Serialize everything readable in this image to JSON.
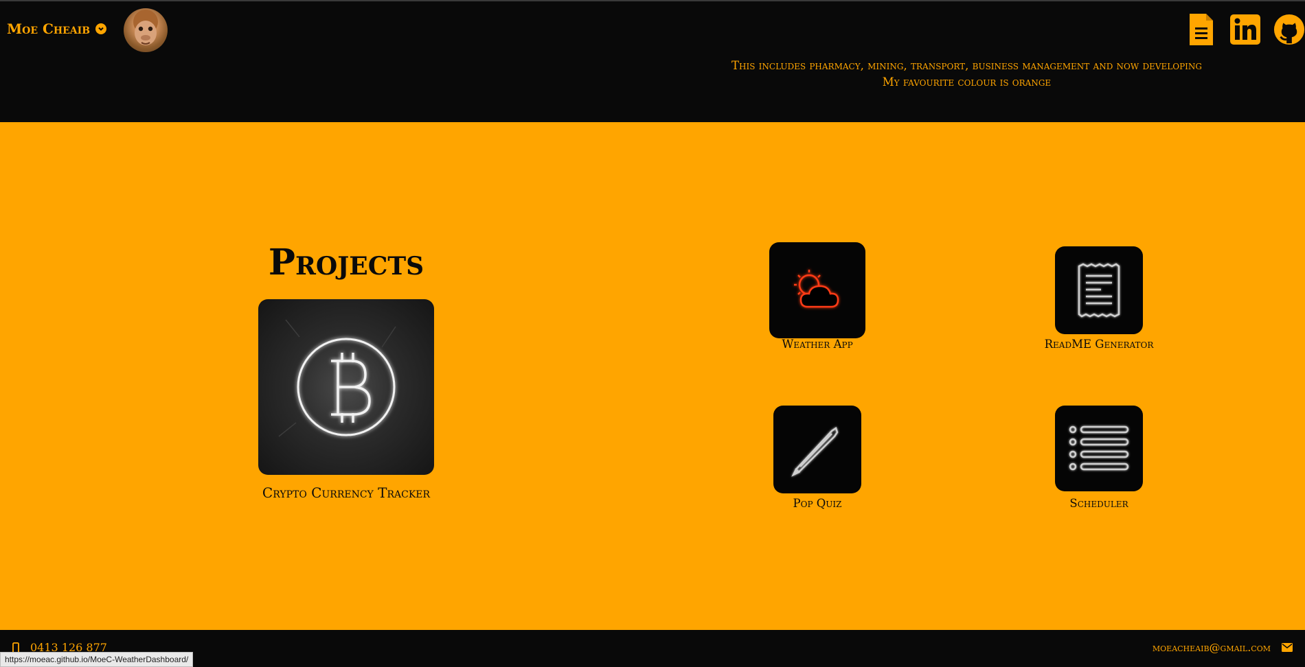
{
  "header": {
    "name": "Moe Cheaib",
    "tagline_lines": [
      "This includes pharmacy, mining, transport, business management and now developing",
      "My favourite colour is orange"
    ],
    "icons": [
      "resume-document-icon",
      "linkedin-icon",
      "github-icon"
    ]
  },
  "projects": {
    "title": "Projects",
    "featured": {
      "label": "Crypto Currency Tracker",
      "icon": "bitcoin-neon-icon"
    },
    "items": [
      {
        "label": "Weather App",
        "icon": "weather-cloud-sun-icon"
      },
      {
        "label": "ReadME Generator",
        "icon": "receipt-document-icon"
      },
      {
        "label": "Pop Quiz",
        "icon": "pencil-icon"
      },
      {
        "label": "Scheduler",
        "icon": "list-icon"
      }
    ]
  },
  "footer": {
    "phone": "0413 126 877",
    "email": "moeacheaib@gmail.com"
  },
  "status_bar": {
    "url": "https://moeac.github.io/MoeC-WeatherDashboard/"
  },
  "colors": {
    "accent": "#ffa500",
    "dark": "#090909"
  }
}
